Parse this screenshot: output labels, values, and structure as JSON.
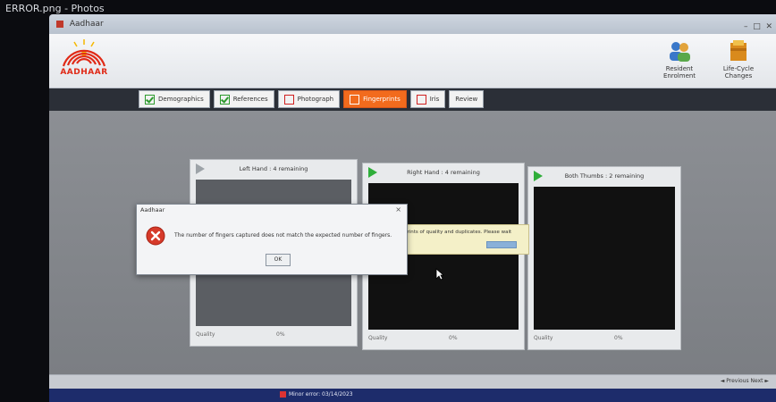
{
  "viewer": {
    "title": "ERROR.png - Photos"
  },
  "app": {
    "title": "Aadhaar",
    "logo_text": "AADHAAR",
    "tools": [
      {
        "label": "Resident Enrolment",
        "icon": "people-icon"
      },
      {
        "label": "Life-Cycle Changes",
        "icon": "folder-icon"
      }
    ]
  },
  "tabs": [
    {
      "label": "Demographics",
      "status": "done"
    },
    {
      "label": "References",
      "status": "done"
    },
    {
      "label": "Photograph",
      "status": "pending"
    },
    {
      "label": "Fingerprints",
      "status": "pending",
      "active": true
    },
    {
      "label": "Iris",
      "status": "pending"
    },
    {
      "label": "Review",
      "status": "none"
    }
  ],
  "panels": [
    {
      "title": "Left Hand : 4 remaining",
      "quality_label": "Quality",
      "percent": "0%"
    },
    {
      "title": "Right Hand : 4 remaining",
      "quality_label": "Quality",
      "percent": "0%"
    },
    {
      "title": "Both Thumbs : 2 remaining",
      "quality_label": "Quality",
      "percent": "0%"
    }
  ],
  "notice": {
    "text": "prints of quality and duplicates. Please wait"
  },
  "dialog": {
    "title": "Aadhaar",
    "message": "The number of fingers captured does not match the expected number of fingers.",
    "ok_label": "OK",
    "close_label": "×"
  },
  "nav": {
    "text": "◄ Previous   Next ►"
  },
  "status": {
    "left": "",
    "items": [
      "Minor error: 03/14/2023"
    ]
  },
  "colors": {
    "active_tab": "#f26b1d",
    "done_check": "#2d9a2d",
    "status_bar": "#1d2c6b",
    "error_icon": "#d63a2a"
  }
}
